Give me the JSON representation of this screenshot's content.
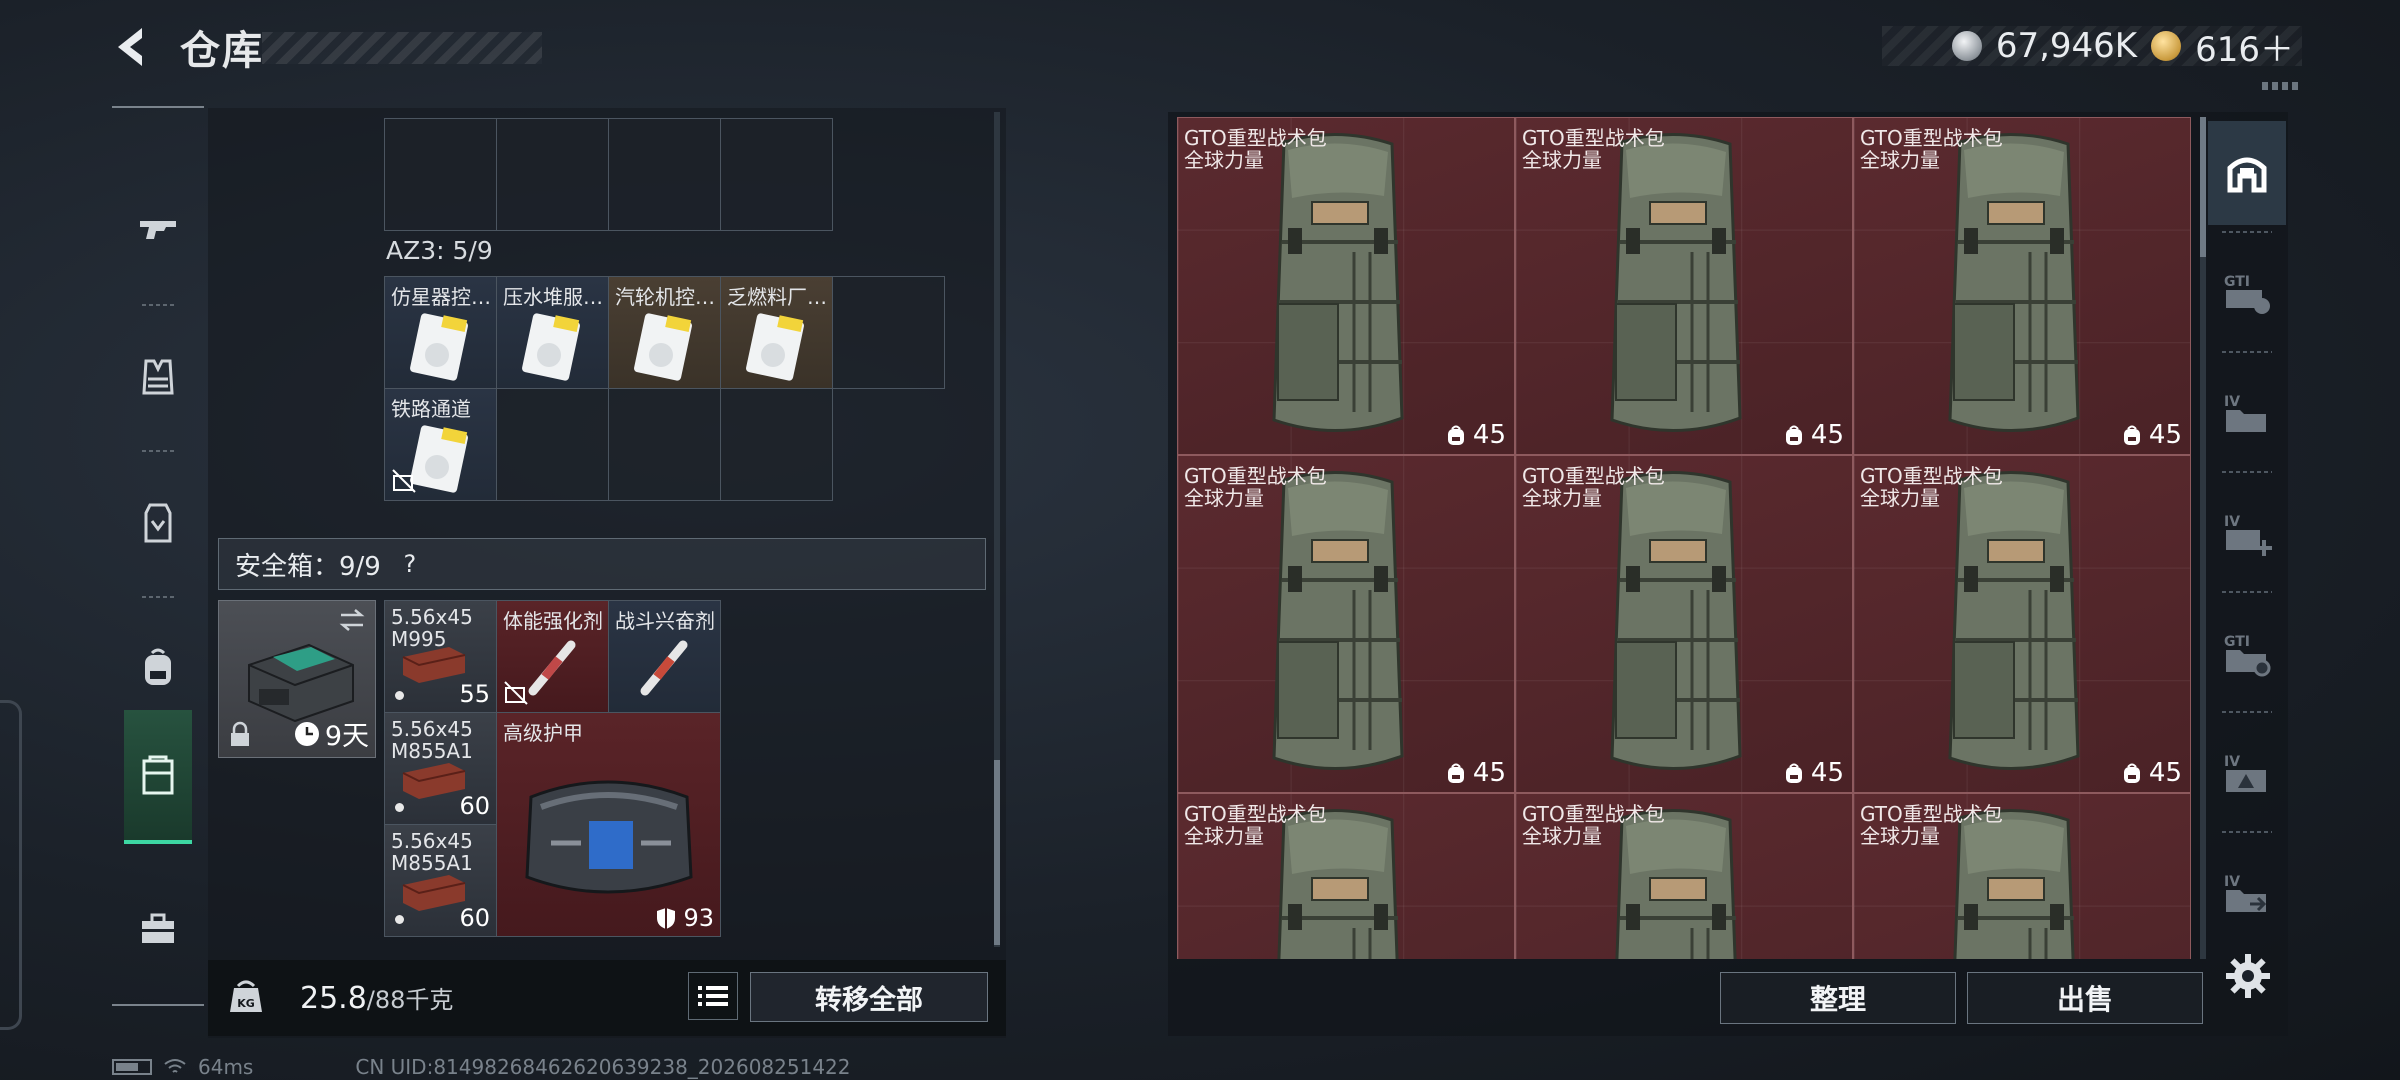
{
  "header": {
    "title": "仓库",
    "currency": [
      {
        "name": "silver-coin",
        "value": "67,946K"
      },
      {
        "name": "gold-coin",
        "value": "616＋"
      }
    ]
  },
  "left_sidebar": {
    "items": [
      {
        "name": "weapon-icon",
        "active": false
      },
      {
        "name": "vest-icon",
        "active": false
      },
      {
        "name": "armor-icon",
        "active": false
      },
      {
        "name": "backpack-icon",
        "active": false
      },
      {
        "name": "container-icon",
        "active": true
      },
      {
        "name": "toolbox-icon",
        "active": false
      }
    ]
  },
  "stash": {
    "az_label": "AZ3: 5/9",
    "keycards": [
      {
        "name": "仿星器控…",
        "bg": "blue"
      },
      {
        "name": "压水堆服…",
        "bg": "blue"
      },
      {
        "name": "汽轮机控…",
        "bg": "brown"
      },
      {
        "name": "乏燃料厂…",
        "bg": "brown"
      },
      {
        "name": "铁路通道",
        "bg": "blue"
      }
    ],
    "safe_label": "安全箱：9/9",
    "help": "?",
    "safe_timer": "9天",
    "safe_items": [
      {
        "line1": "5.56x45",
        "line2": "M995",
        "qty": "55"
      },
      {
        "line1": "体能强化剂",
        "line2": "",
        "qty": ""
      },
      {
        "line1": "战斗兴奋剂",
        "line2": "",
        "qty": ""
      },
      {
        "line1": "5.56x45",
        "line2": "M855A1",
        "qty": "60"
      },
      {
        "line1": "高级护甲",
        "line2": "",
        "qty": "93"
      },
      {
        "line1": "5.56x45",
        "line2": "M855A1",
        "qty": "60"
      }
    ]
  },
  "weight": {
    "current": "25.8",
    "max": "/88千克",
    "kg_label": "KG"
  },
  "buttons": {
    "transfer_all": "转移全部",
    "sort": "整理",
    "sell": "出售"
  },
  "status": {
    "ping": "64ms",
    "uid": "CN UID:8149826846262063923​8_202608251422"
  },
  "bags": [
    {
      "name": "GTO重型战术包",
      "sub": "全球力量",
      "capacity": "45"
    },
    {
      "name": "GTO重型战术包",
      "sub": "全球力量",
      "capacity": "45"
    },
    {
      "name": "GTO重型战术包",
      "sub": "全球力量",
      "capacity": "45"
    },
    {
      "name": "GTO重型战术包",
      "sub": "全球力量",
      "capacity": "45"
    },
    {
      "name": "GTO重型战术包",
      "sub": "全球力量",
      "capacity": "45"
    },
    {
      "name": "GTO重型战术包",
      "sub": "全球力量",
      "capacity": "45"
    },
    {
      "name": "GTO重型战术包",
      "sub": "全球力量",
      "capacity": ""
    },
    {
      "name": "GTO重型战术包",
      "sub": "全球力量",
      "capacity": ""
    },
    {
      "name": "GTO重型战术包",
      "sub": "全球力量",
      "capacity": ""
    }
  ],
  "right_sidebar": {
    "items": [
      {
        "name": "stash-home-icon",
        "active": true
      },
      {
        "name": "gti-tag-icon",
        "label": "GTI"
      },
      {
        "name": "iv-folder-icon",
        "label": "IV"
      },
      {
        "name": "iv-plus-icon",
        "label": "IV"
      },
      {
        "name": "gti-folder-icon",
        "label": "GTI"
      },
      {
        "name": "iv-triangle-icon",
        "label": "IV"
      },
      {
        "name": "iv-arrow-icon",
        "label": "IV"
      }
    ]
  }
}
